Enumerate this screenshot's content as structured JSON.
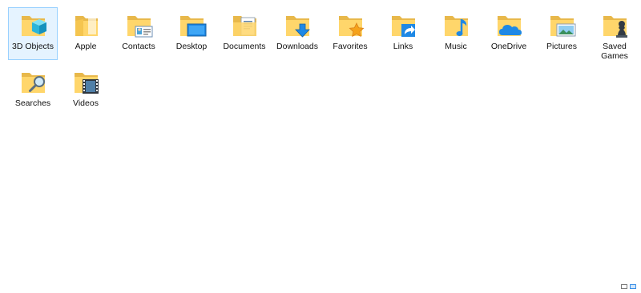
{
  "folders": [
    {
      "name": "3D Objects",
      "icon": "cube-3d-icon"
    },
    {
      "name": "Apple",
      "icon": "folder-icon"
    },
    {
      "name": "Contacts",
      "icon": "contact-card-icon"
    },
    {
      "name": "Desktop",
      "icon": "monitor-icon"
    },
    {
      "name": "Documents",
      "icon": "document-icon"
    },
    {
      "name": "Downloads",
      "icon": "download-arrow-icon"
    },
    {
      "name": "Favorites",
      "icon": "star-icon"
    },
    {
      "name": "Links",
      "icon": "link-arrow-icon"
    },
    {
      "name": "Music",
      "icon": "music-note-icon"
    },
    {
      "name": "OneDrive",
      "icon": "cloud-icon"
    },
    {
      "name": "Pictures",
      "icon": "picture-icon"
    },
    {
      "name": "Saved Games",
      "icon": "chess-piece-icon"
    },
    {
      "name": "Searches",
      "icon": "magnifier-icon"
    },
    {
      "name": "Videos",
      "icon": "film-strip-icon"
    }
  ],
  "selected_index": 0,
  "colors": {
    "folder_back": "#e8b84a",
    "folder_front": "#ffd66b",
    "selection_bg": "#e5f3ff",
    "selection_border": "#99d1ff",
    "accent_blue": "#1e88e5"
  }
}
